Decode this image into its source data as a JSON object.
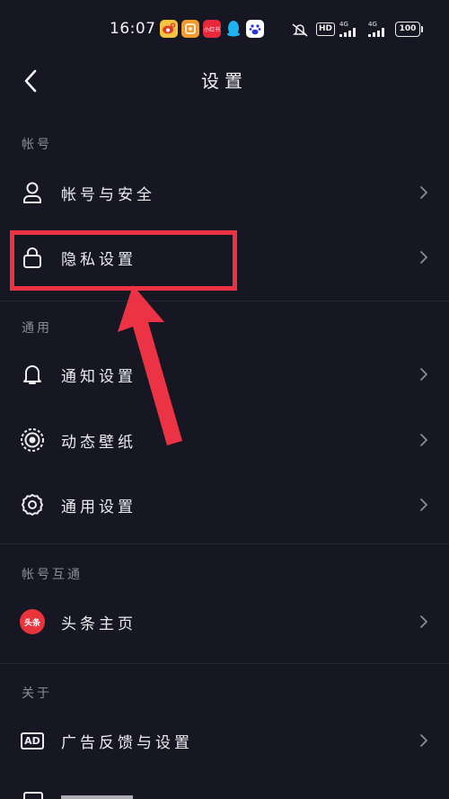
{
  "status_bar": {
    "time": "16:07",
    "hd": "HD",
    "net1": "4G",
    "net2": "4G",
    "battery": "100",
    "app_icons": [
      "weibo-icon",
      "app-icon",
      "xiaohongshu-icon",
      "qq-icon",
      "baidu-icon"
    ],
    "xiaohongshu_text": "小红书"
  },
  "header": {
    "title": "设置"
  },
  "sections": {
    "account": {
      "label": "帐号",
      "items": [
        {
          "label": "帐号与安全",
          "icon": "user-icon"
        },
        {
          "label": "隐私设置",
          "icon": "lock-icon"
        }
      ]
    },
    "general": {
      "label": "通用",
      "items": [
        {
          "label": "通知设置",
          "icon": "bell-icon"
        },
        {
          "label": "动态壁纸",
          "icon": "live-wallpaper-icon"
        },
        {
          "label": "通用设置",
          "icon": "gear-icon"
        }
      ]
    },
    "linked": {
      "label": "帐号互通",
      "items": [
        {
          "label": "头条主页",
          "icon": "toutiao-icon",
          "badge": "头条"
        }
      ]
    },
    "about": {
      "label": "关于",
      "items": [
        {
          "label": "广告反馈与设置",
          "icon": "ad-icon",
          "badge": "AD"
        }
      ]
    }
  },
  "colors": {
    "background": "#161722",
    "annotation": "#ec3345",
    "section_label": "#8b8c95"
  }
}
